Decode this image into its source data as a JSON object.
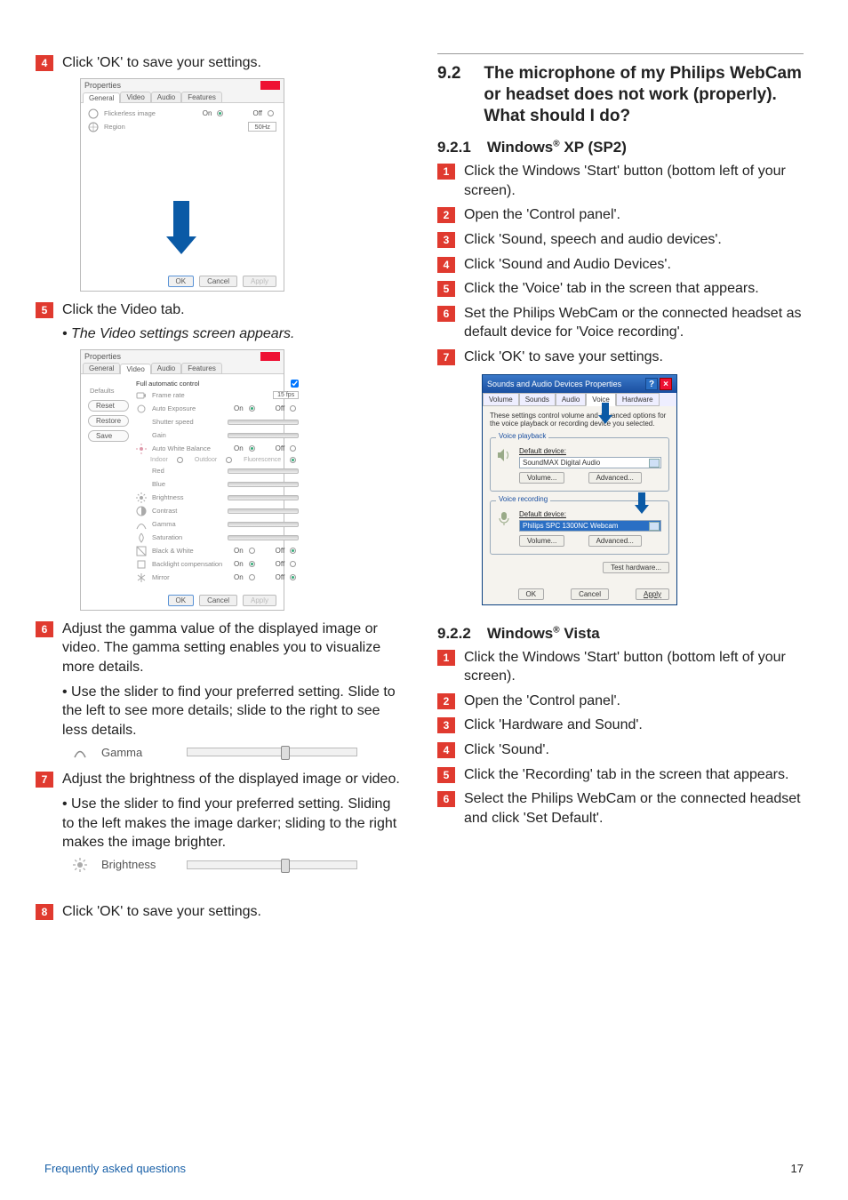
{
  "footer": {
    "title": "Frequently asked questions",
    "page": "17"
  },
  "left": {
    "steps": {
      "s4": "Click 'OK' to save your settings.",
      "s5": "Click the Video tab.",
      "s5_sub": "The Video settings screen appears.",
      "s6": "Adjust the gamma value of the displayed image or video. The gamma setting enables you to visualize more details.",
      "s6_b": "Use the slider to find your preferred setting.  Slide to the left to see more details; slide to the right to see less details.",
      "s7": "Adjust the brightness of the displayed image or video.",
      "s7_b": "Use the slider to find your preferred setting.  Sliding to the left makes the image darker; sliding to the right makes the image brighter.",
      "s8": "Click 'OK' to save your settings."
    },
    "samples": {
      "gamma": "Gamma",
      "brightness": "Brightness"
    },
    "dialog1": {
      "title": "Properties",
      "tabs": [
        "General",
        "Video",
        "Audio",
        "Features"
      ],
      "rows": {
        "flickerless": "Flickerless image",
        "region": "Region",
        "on": "On",
        "off": "Off",
        "hz": "50Hz"
      },
      "btns": {
        "ok": "OK",
        "cancel": "Cancel",
        "apply": "Apply"
      }
    },
    "dialog2": {
      "title": "Properties",
      "tabs": [
        "General",
        "Video",
        "Audio",
        "Features"
      ],
      "defaults": "Defaults",
      "sidebtns": [
        "Reset",
        "Restore",
        "Save"
      ],
      "fac": "Full automatic control",
      "rows": {
        "framerate": "Frame rate",
        "fps": "15 fps",
        "autoexp": "Auto Exposure",
        "shutter": "Shutter speed",
        "gain": "Gain",
        "awb": "Auto White Balance",
        "indoor": "Indoor",
        "outdoor": "Outdoor",
        "fluor": "Fluorescence",
        "red": "Red",
        "blue": "Blue",
        "brightness": "Brightness",
        "contrast": "Contrast",
        "gamma": "Gamma",
        "saturation": "Saturation",
        "bw": "Black & White",
        "backlight": "Backlight compensation",
        "mirror": "Mirror",
        "on": "On",
        "off": "Off"
      },
      "btns": {
        "ok": "OK",
        "cancel": "Cancel",
        "apply": "Apply"
      }
    }
  },
  "right": {
    "sec92_num": "9.2",
    "sec92_title": "The microphone of my Philips WebCam or headset does not work (properly). What should I do?",
    "sec921_num": "9.2.1",
    "sec921_title_a": "Windows",
    "sec921_title_b": " XP (SP2)",
    "xp_steps": {
      "s1": "Click the Windows 'Start' button (bottom left of your screen).",
      "s2": "Open the 'Control panel'.",
      "s3": "Click 'Sound, speech and audio devices'.",
      "s4": "Click 'Sound and Audio Devices'.",
      "s5": "Click the 'Voice' tab in the screen that appears.",
      "s6": "Set the Philips WebCam or the connected headset as default device for 'Voice recording'.",
      "s7": "Click 'OK' to save your settings."
    },
    "voice_dialog": {
      "title": "Sounds and Audio Devices Properties",
      "tabs": [
        "Volume",
        "Sounds",
        "Audio",
        "Voice",
        "Hardware"
      ],
      "intro": "These settings control volume and advanced options for the voice playback or recording device you selected.",
      "playback": {
        "legend": "Voice playback",
        "label": "Default device:",
        "value": "SoundMAX Digital Audio",
        "btn1": "Volume...",
        "btn2": "Advanced..."
      },
      "recording": {
        "legend": "Voice recording",
        "label": "Default device:",
        "value": "Philips SPC 1300NC Webcam",
        "btn1": "Volume...",
        "btn2": "Advanced..."
      },
      "test": "Test hardware...",
      "btns": {
        "ok": "OK",
        "cancel": "Cancel",
        "apply": "Apply"
      }
    },
    "sec922_num": "9.2.2",
    "sec922_title_a": "Windows",
    "sec922_title_b": " Vista",
    "vista_steps": {
      "s1": "Click the Windows 'Start' button (bottom left of your screen).",
      "s2": "Open the 'Control panel'.",
      "s3": "Click 'Hardware and Sound'.",
      "s4": "Click 'Sound'.",
      "s5": "Click the 'Recording' tab in the screen that appears.",
      "s6": "Select the Philips WebCam or the connected headset and click 'Set Default'."
    }
  }
}
